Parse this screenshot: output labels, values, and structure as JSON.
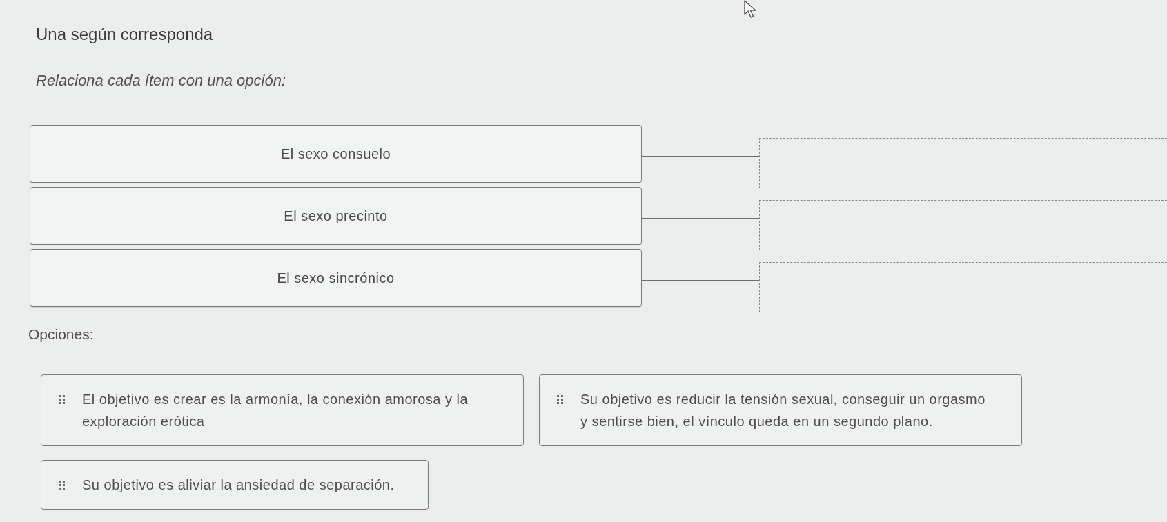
{
  "title": "Una según corresponda",
  "instruction": "Relaciona cada ítem con una opción:",
  "items": [
    {
      "label": "El sexo consuelo"
    },
    {
      "label": "El sexo precinto"
    },
    {
      "label": "El sexo sincrónico"
    }
  ],
  "options_heading": "Opciones:",
  "options": [
    {
      "text": "El objetivo es crear es la armonía, la conexión amorosa y la exploración erótica"
    },
    {
      "text": "Su objetivo es reducir la tensión sexual, conseguir un orgasmo y sentirse bien, el vínculo queda en un segundo plano."
    },
    {
      "text": "Su objetivo es aliviar la ansiedad de separación."
    }
  ]
}
